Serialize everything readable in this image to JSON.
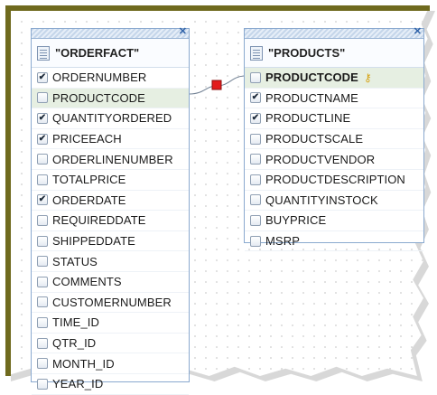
{
  "colors": {
    "frame": "#6f6a1e",
    "table_border": "#8aa9cf",
    "highlight_row": "#e6efe2",
    "link_marker": "#e31c1c",
    "key_icon": "#d6a417"
  },
  "icons": {
    "close": "close-icon",
    "table": "table-icon",
    "checkbox": "checkbox-icon",
    "key": "key-icon"
  },
  "glyphs": {
    "close": "✕",
    "check": "✔",
    "key": "⚷"
  },
  "tables": {
    "orderfact": {
      "title": "\"ORDERFACT\"",
      "fields": [
        {
          "name": "ORDERNUMBER",
          "checked": true
        },
        {
          "name": "PRODUCTCODE",
          "checked": false,
          "highlighted": true
        },
        {
          "name": "QUANTITYORDERED",
          "checked": true
        },
        {
          "name": "PRICEEACH",
          "checked": true
        },
        {
          "name": "ORDERLINENUMBER",
          "checked": false
        },
        {
          "name": "TOTALPRICE",
          "checked": false
        },
        {
          "name": "ORDERDATE",
          "checked": true
        },
        {
          "name": "REQUIREDDATE",
          "checked": false
        },
        {
          "name": "SHIPPEDDATE",
          "checked": false
        },
        {
          "name": "STATUS",
          "checked": false
        },
        {
          "name": "COMMENTS",
          "checked": false
        },
        {
          "name": "CUSTOMERNUMBER",
          "checked": false
        },
        {
          "name": "TIME_ID",
          "checked": false
        },
        {
          "name": "QTR_ID",
          "checked": false
        },
        {
          "name": "MONTH_ID",
          "checked": false
        },
        {
          "name": "YEAR_ID",
          "checked": false
        }
      ]
    },
    "products": {
      "title": "\"PRODUCTS\"",
      "fields": [
        {
          "name": "PRODUCTCODE",
          "checked": false,
          "highlighted": true,
          "bold": true,
          "key": true
        },
        {
          "name": "PRODUCTNAME",
          "checked": true
        },
        {
          "name": "PRODUCTLINE",
          "checked": true
        },
        {
          "name": "PRODUCTSCALE",
          "checked": false
        },
        {
          "name": "PRODUCTVENDOR",
          "checked": false
        },
        {
          "name": "PRODUCTDESCRIPTION",
          "checked": false
        },
        {
          "name": "QUANTITYINSTOCK",
          "checked": false
        },
        {
          "name": "BUYPRICE",
          "checked": false
        },
        {
          "name": "MSRP",
          "checked": false
        }
      ]
    }
  }
}
